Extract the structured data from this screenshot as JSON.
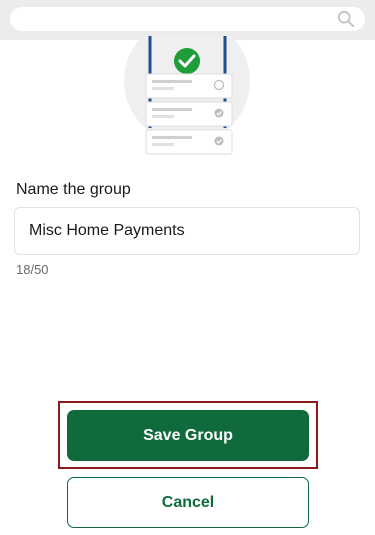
{
  "search": {
    "placeholder": "",
    "icon": "search-icon"
  },
  "illustration": {
    "icon": "group-checklist-illustration",
    "accent": "#1f9d3a",
    "frame": "#1f4f8f"
  },
  "form": {
    "label": "Name the group",
    "value": "Misc Home Payments",
    "char_count": "18/50"
  },
  "actions": {
    "save_label": "Save Group",
    "cancel_label": "Cancel"
  },
  "colors": {
    "primary": "#0f6b3c",
    "highlight": "#8b1a1a",
    "background": "#ffffff"
  }
}
